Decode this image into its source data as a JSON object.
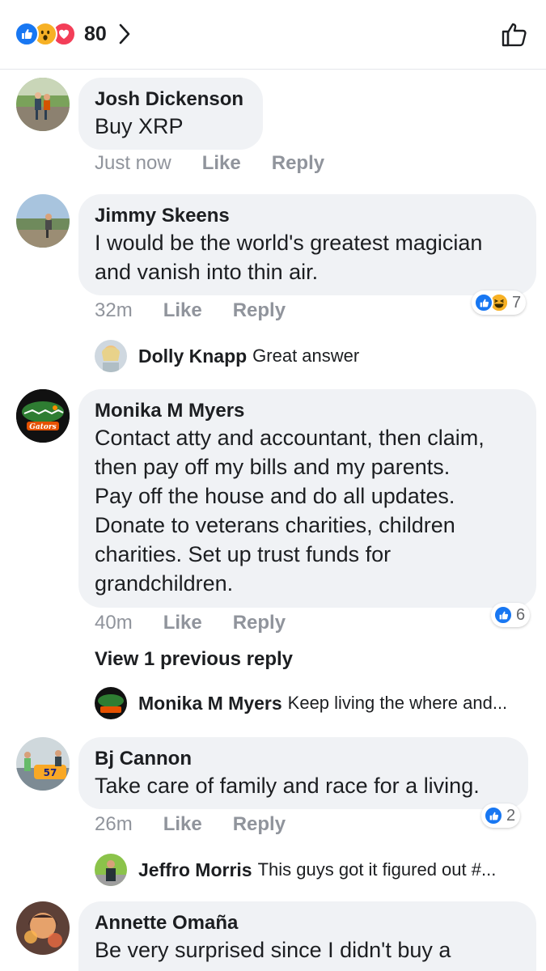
{
  "header": {
    "reaction_count": "80",
    "reaction_icons": [
      "like-icon",
      "wow-icon",
      "love-icon"
    ]
  },
  "comments": [
    {
      "author": "Josh Dickenson",
      "text_lines": [
        "Buy XRP"
      ],
      "time": "Just now",
      "like_label": "Like",
      "reply_label": "Reply"
    },
    {
      "author": "Jimmy Skeens",
      "text_lines": [
        "I would be the world's greatest magician",
        "and vanish into thin air."
      ],
      "time": "32m",
      "like_label": "Like",
      "reply_label": "Reply",
      "reaction_count": "7",
      "reply": {
        "author": "Dolly Knapp",
        "text": "Great answer"
      }
    },
    {
      "author": "Monika M Myers",
      "text_lines": [
        "Contact atty and accountant, then claim,",
        "then pay off my bills and my parents.",
        "Pay off the house and do all updates.",
        "Donate to veterans charities, children",
        "charities. Set up trust funds for",
        "grandchildren."
      ],
      "time": "40m",
      "like_label": "Like",
      "reply_label": "Reply",
      "reaction_count": "6",
      "view_previous": "View 1 previous reply",
      "reply": {
        "author": "Monika M Myers",
        "text": "Keep living the where and..."
      }
    },
    {
      "author": "Bj Cannon",
      "text_lines": [
        "Take care of family and race for a living."
      ],
      "time": "26m",
      "like_label": "Like",
      "reply_label": "Reply",
      "reaction_count": "2",
      "reply": {
        "author": "Jeffro Morris",
        "text": "This guys got it figured out #..."
      }
    },
    {
      "author": "Annette Omaña",
      "text_lines": [
        "Be very surprised since I didn't buy a"
      ]
    }
  ]
}
